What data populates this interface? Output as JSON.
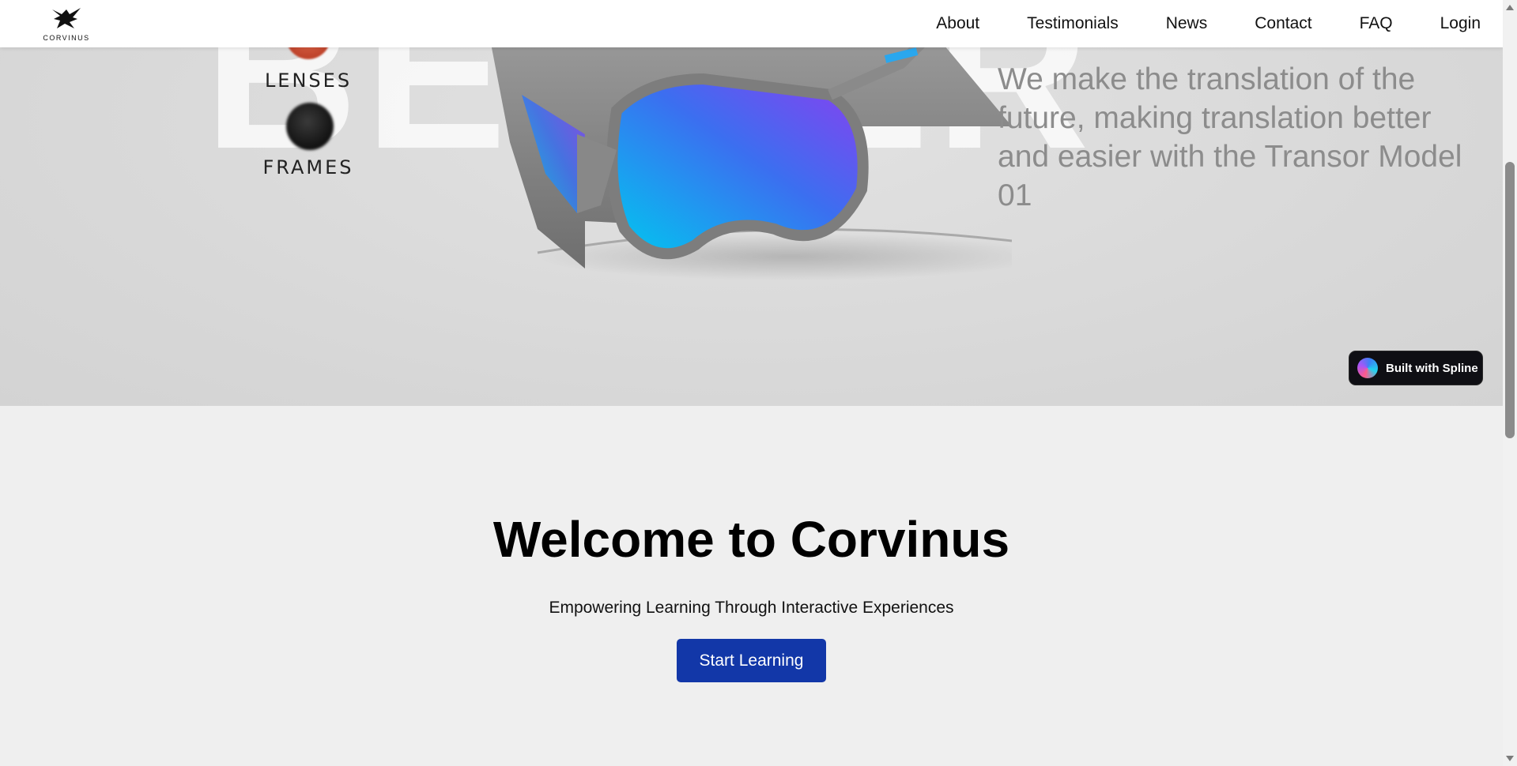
{
  "navbar": {
    "logo_text": "CORVINUS",
    "links": [
      "About",
      "Testimonials",
      "News",
      "Contact",
      "FAQ",
      "Login"
    ]
  },
  "hero": {
    "background_word": "BETTER",
    "options": [
      "LENSES",
      "FRAMES"
    ],
    "tagline": "We make the translation of the future, making translation better and easier with the Transor Model 01",
    "badge": "Built with Spline"
  },
  "welcome": {
    "title": "Welcome to Corvinus",
    "subtitle": "Empowering Learning Through Interactive Experiences",
    "cta_label": "Start Learning"
  },
  "colors": {
    "cta": "#1237a8",
    "lens_gradient": [
      "#00c8ef",
      "#3b6ff0",
      "#8a3ff0"
    ],
    "hero_bg": "#d9d9d9"
  }
}
